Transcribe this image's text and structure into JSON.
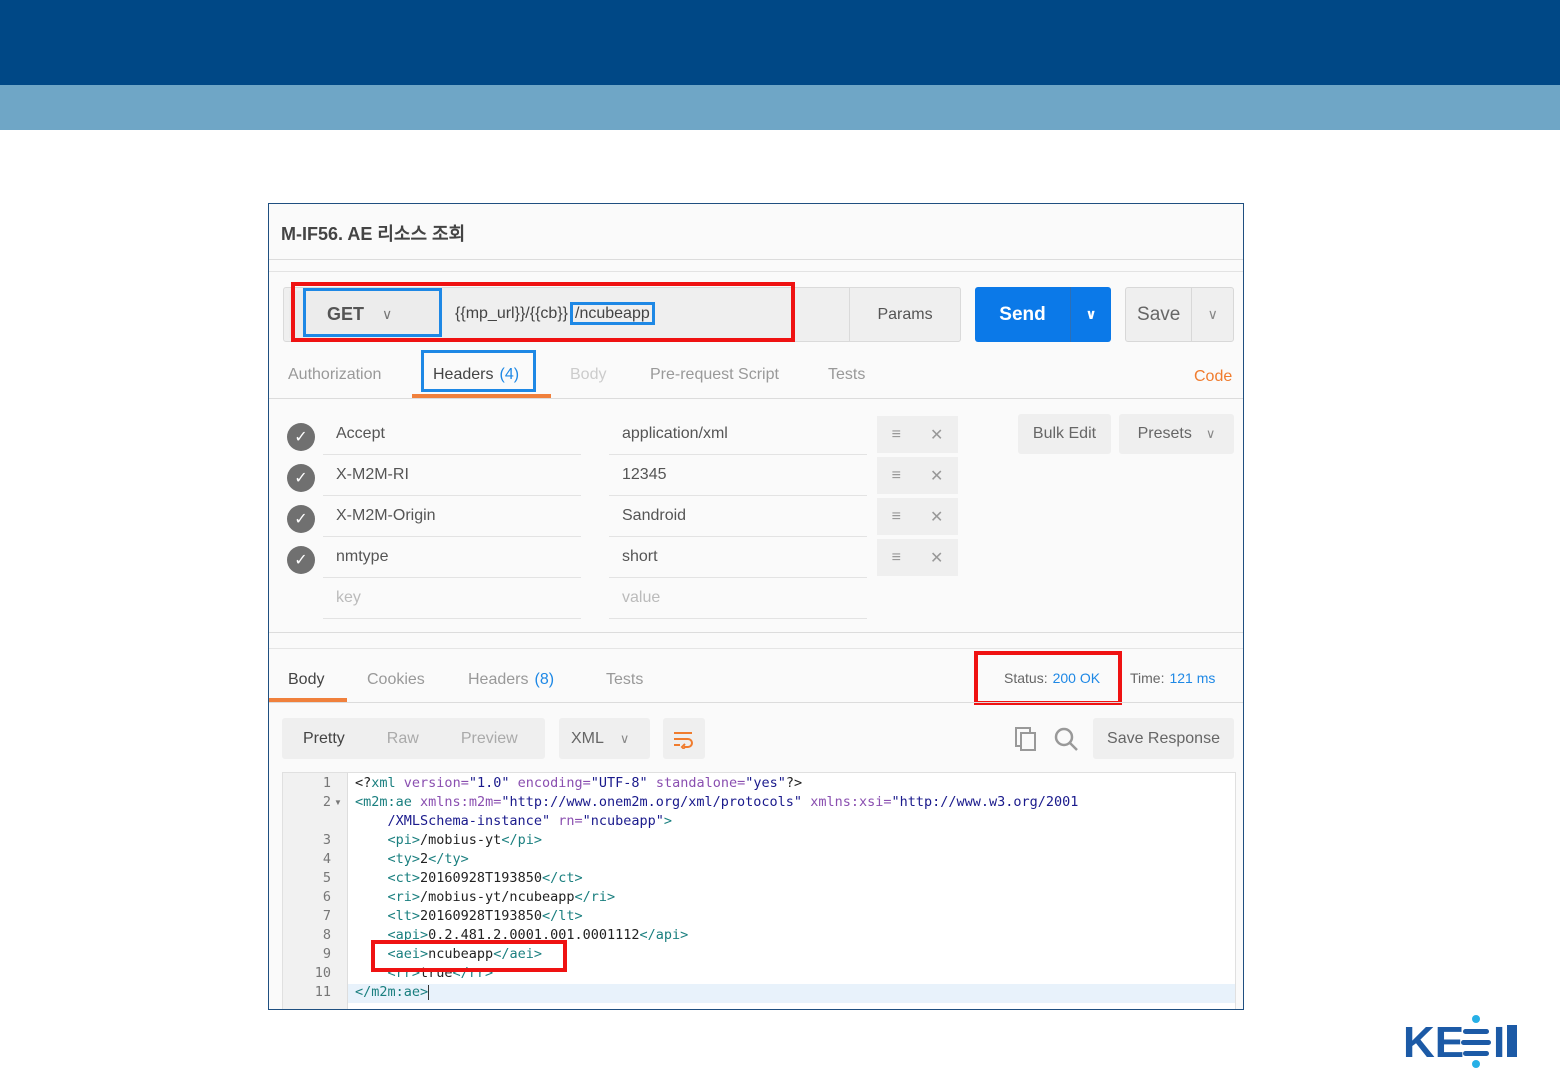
{
  "request": {
    "title": "M-IF56. AE 리소스 조회",
    "method": "GET",
    "url_prefix": "{{mp_url}}/{{cb}}",
    "url_path": "/ncubeapp",
    "params_label": "Params",
    "send_label": "Send",
    "save_label": "Save",
    "tabs": [
      {
        "label": "Authorization"
      },
      {
        "label": "Headers",
        "count": "(4)"
      },
      {
        "label": "Body"
      },
      {
        "label": "Pre-request Script"
      },
      {
        "label": "Tests"
      }
    ],
    "code_link": "Code",
    "bulk_edit": "Bulk Edit",
    "presets": "Presets",
    "headers": [
      {
        "key": "Accept",
        "value": "application/xml"
      },
      {
        "key": "X-M2M-RI",
        "value": "12345"
      },
      {
        "key": "X-M2M-Origin",
        "value": "Sandroid"
      },
      {
        "key": "nmtype",
        "value": "short"
      }
    ],
    "key_placeholder": "key",
    "value_placeholder": "value"
  },
  "response": {
    "tabs": [
      {
        "label": "Body"
      },
      {
        "label": "Cookies"
      },
      {
        "label": "Headers",
        "count": "(8)"
      },
      {
        "label": "Tests"
      }
    ],
    "status_label": "Status:",
    "status_value": "200 OK",
    "time_label": "Time:",
    "time_value": "121 ms",
    "views": [
      "Pretty",
      "Raw",
      "Preview"
    ],
    "format": "XML",
    "save_response": "Save Response",
    "line_numbers": [
      "1",
      "2",
      "",
      "3",
      "4",
      "5",
      "6",
      "7",
      "8",
      "9",
      "10",
      "11"
    ]
  },
  "accent_colors": {
    "header_bar": "#004886",
    "sub_bar": "#6fa6c6",
    "send": "#0b79e8",
    "highlight_red": "#ef1212",
    "highlight_blue": "#1e88e5",
    "tab_active": "#f0803c"
  },
  "logo_text": "KETI"
}
